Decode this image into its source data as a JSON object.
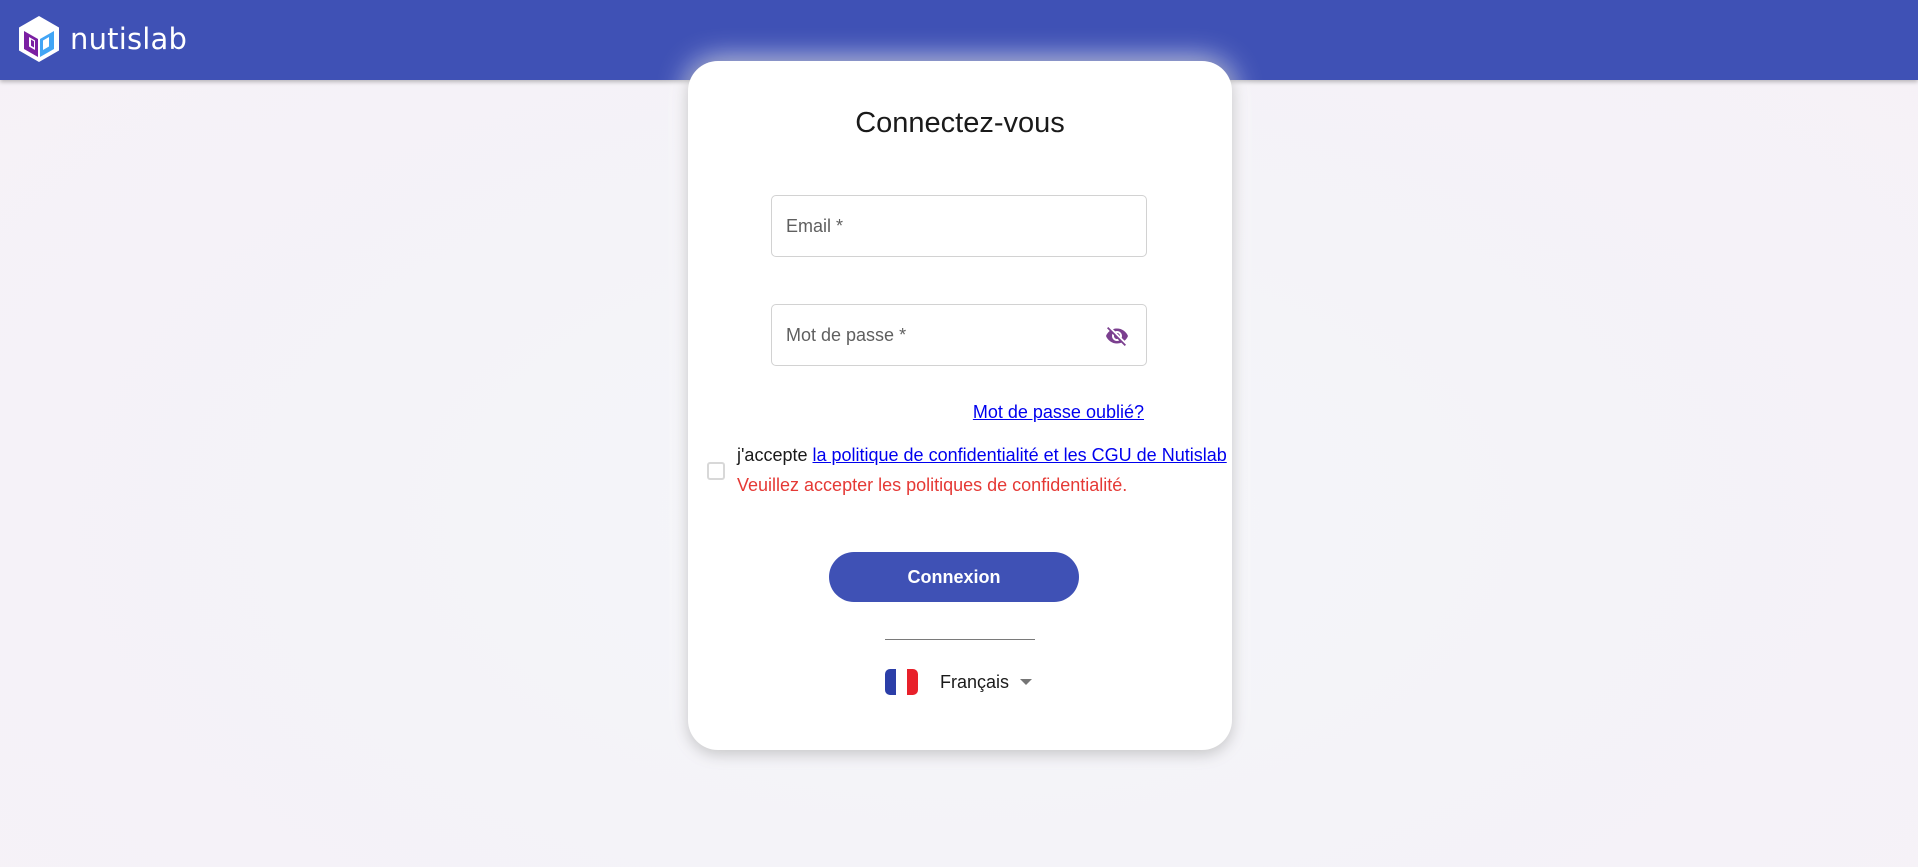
{
  "app": {
    "name": "nutislab",
    "brand_color": "#3f51b5",
    "logo_icon": "cube-logo-icon"
  },
  "login": {
    "title": "Connectez-vous",
    "email_placeholder": "Email *",
    "email_value": "",
    "password_placeholder": "Mot de passe *",
    "password_value": "",
    "password_toggle_icon": "eye-off-icon",
    "forgot_password": "Mot de passe oublié?",
    "accept_prefix": "j'accepte ",
    "accept_link": "la politique de confidentialité et les CGU de Nutislab",
    "accept_checked": false,
    "error_message": "Veuillez accepter les politiques de confidentialité.",
    "error_color": "#e53935",
    "submit_label": "Connexion"
  },
  "language": {
    "selected": "Français",
    "flag_icon": "france-flag-icon",
    "caret_icon": "caret-down-icon"
  }
}
